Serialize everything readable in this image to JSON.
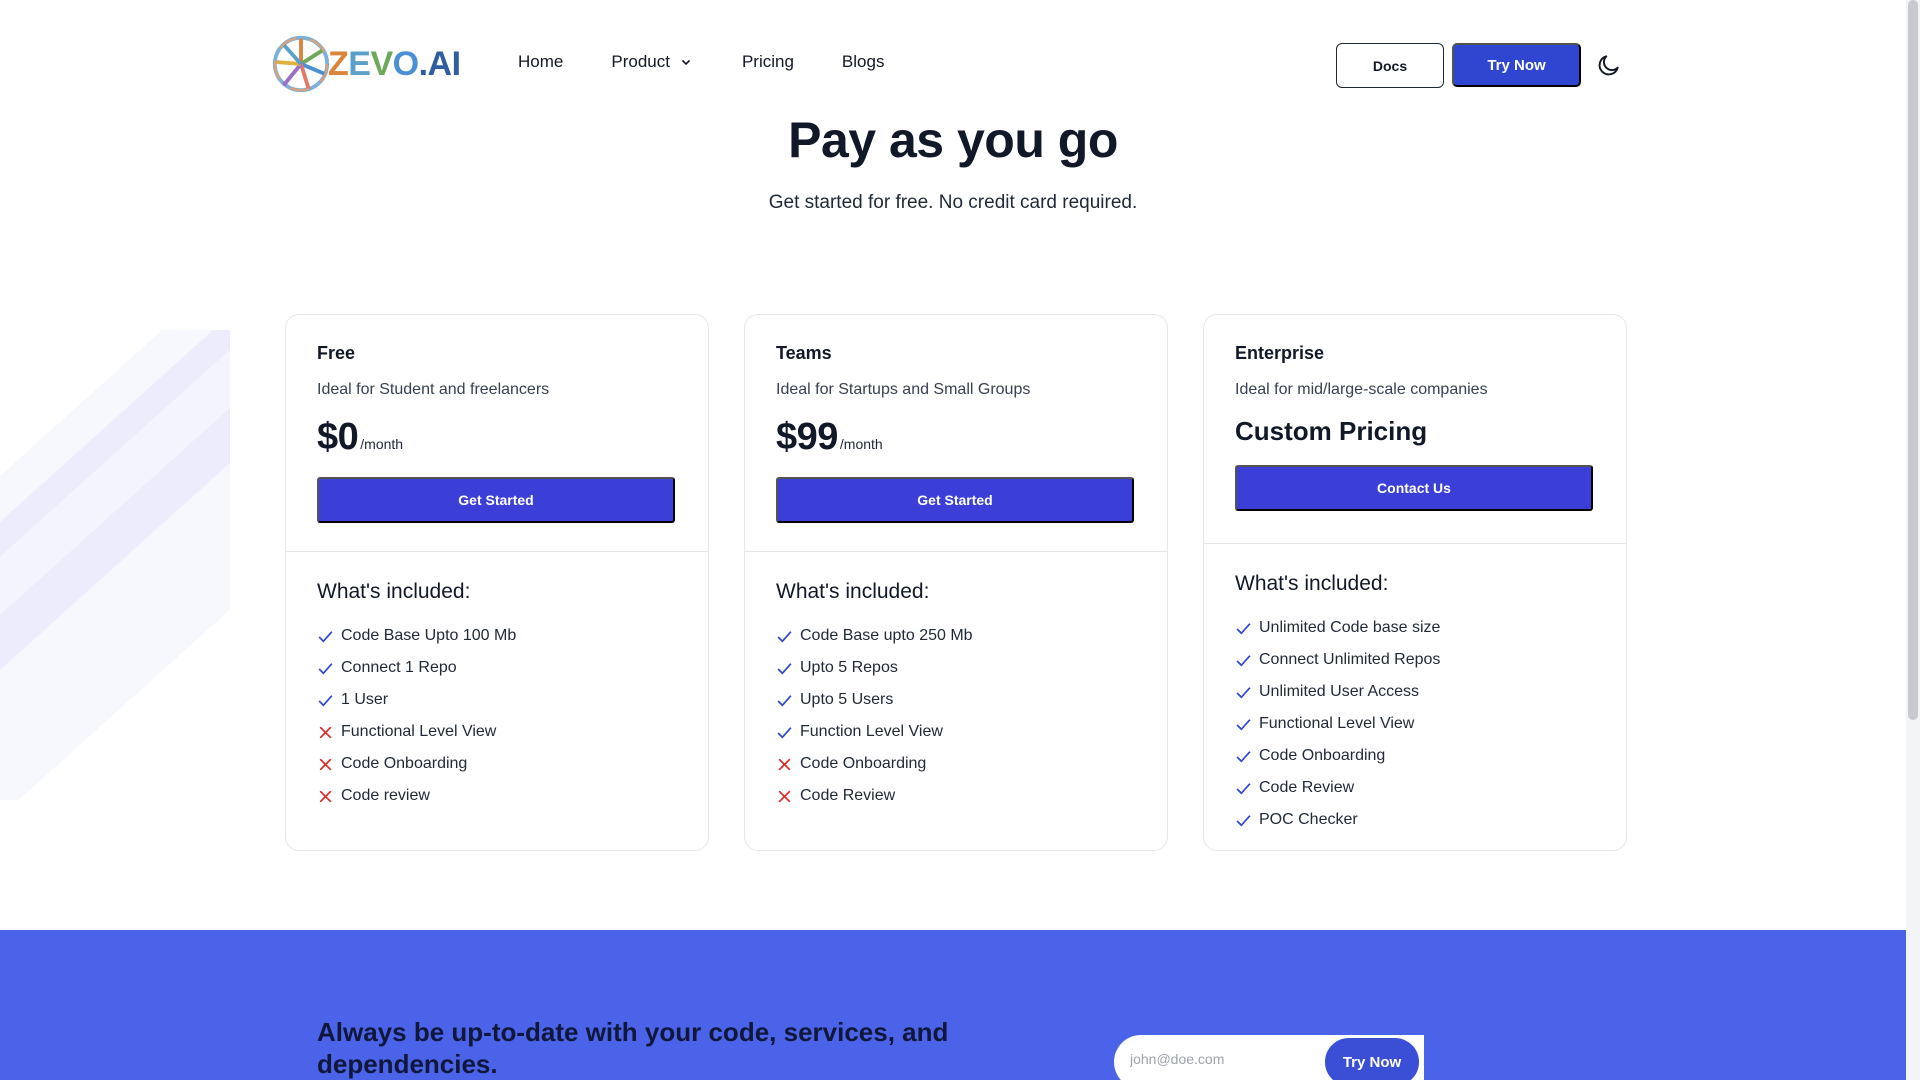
{
  "brand": {
    "logo_text_z": "Z",
    "logo_text_e": "E",
    "logo_text_v": "V",
    "logo_text_o": "O",
    "logo_text_ai": ".AI"
  },
  "nav": {
    "home": "Home",
    "product": "Product",
    "pricing": "Pricing",
    "blogs": "Blogs"
  },
  "header_actions": {
    "docs": "Docs",
    "try_now": "Try Now",
    "theme_icon": "moon-icon"
  },
  "hero": {
    "title": "Pay as you go",
    "subtitle": "Get started for free. No credit card required."
  },
  "plans": [
    {
      "name": "Free",
      "description": "Ideal for Student and freelancers",
      "price": "$0",
      "period": "/month",
      "cta": "Get Started",
      "included_title": "What's included:",
      "features": [
        {
          "text": "Code Base Upto 100 Mb",
          "included": true
        },
        {
          "text": "Connect 1 Repo",
          "included": true
        },
        {
          "text": "1 User",
          "included": true
        },
        {
          "text": "Functional Level View",
          "included": false
        },
        {
          "text": "Code Onboarding",
          "included": false
        },
        {
          "text": "Code review",
          "included": false
        }
      ]
    },
    {
      "name": "Teams",
      "description": "Ideal for Startups and Small Groups",
      "price": "$99",
      "period": "/month",
      "cta": "Get Started",
      "included_title": "What's included:",
      "features": [
        {
          "text": "Code Base upto 250 Mb",
          "included": true
        },
        {
          "text": "Upto 5 Repos",
          "included": true
        },
        {
          "text": "Upto 5 Users",
          "included": true
        },
        {
          "text": "Function Level View",
          "included": true
        },
        {
          "text": "Code Onboarding",
          "included": false
        },
        {
          "text": "Code Review",
          "included": false
        }
      ]
    },
    {
      "name": "Enterprise",
      "description": "Ideal for mid/large-scale companies",
      "price_text": "Custom Pricing",
      "cta": "Contact Us",
      "included_title": "What's included:",
      "features": [
        {
          "text": "Unlimited Code base size",
          "included": true
        },
        {
          "text": "Connect Unlimited Repos",
          "included": true
        },
        {
          "text": "Unlimited User Access",
          "included": true
        },
        {
          "text": "Functional Level View",
          "included": true
        },
        {
          "text": "Code Onboarding",
          "included": true
        },
        {
          "text": "Code Review",
          "included": true
        },
        {
          "text": "POC Checker",
          "included": true
        }
      ]
    }
  ],
  "newsletter": {
    "heading": "Always be up-to-date with your code, services, and dependencies.",
    "placeholder": "john@doe.com",
    "button": "Try Now"
  },
  "colors": {
    "primary": "#3b3fd8",
    "header_button": "#2f46d1",
    "cta_band": "#4a63e8",
    "check": "#2f46d1",
    "cross": "#dc2626"
  }
}
